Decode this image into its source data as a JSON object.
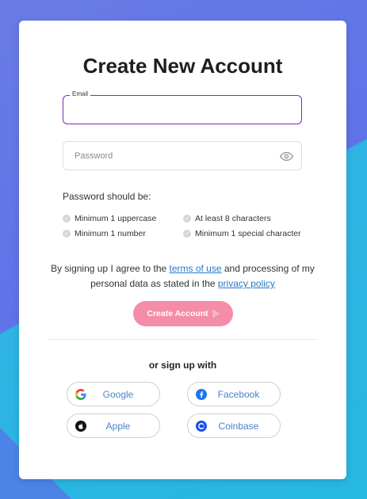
{
  "title": "Create New Account",
  "email": {
    "label": "Email",
    "value": ""
  },
  "password": {
    "placeholder": "Password"
  },
  "requirements": {
    "heading": "Password should be:",
    "items": [
      "Minimum 1 uppercase",
      "At least 8 characters",
      "Minimum 1 number",
      "Minimum 1 special character"
    ]
  },
  "terms": {
    "prefix": "By signing up I agree to the ",
    "terms_link": "terms of use",
    "middle": " and processing of my personal data as stated in the ",
    "privacy_link": "privacy policy"
  },
  "create_button": "Create Account",
  "alt_signup": "or sign up with",
  "social": {
    "google": "Google",
    "facebook": "Facebook",
    "apple": "Apple",
    "coinbase": "Coinbase"
  },
  "colors": {
    "accent_purple": "#7a2bb8",
    "button_pink": "#f58ca8",
    "link_blue": "#2a78c8",
    "facebook_blue": "#1877f2",
    "coinbase_blue": "#1652f0"
  }
}
